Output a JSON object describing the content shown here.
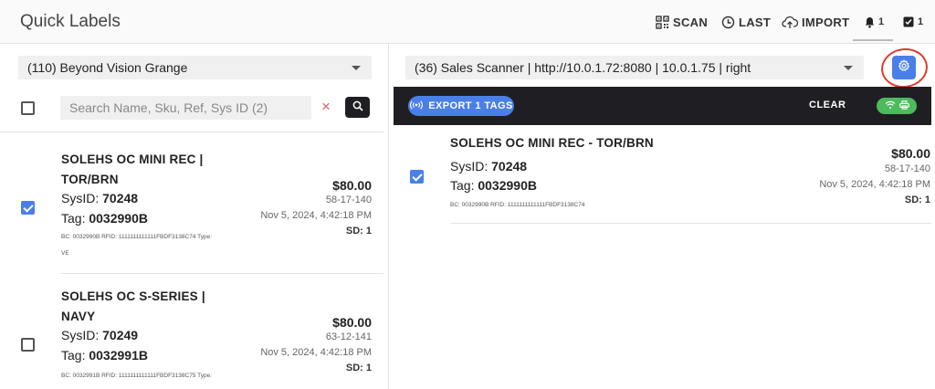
{
  "app": {
    "title": "Quick Labels"
  },
  "nav": {
    "scan_label": "SCAN",
    "last_label": "LAST",
    "import_label": "IMPORT",
    "bell_count": "1",
    "check_count": "1"
  },
  "left": {
    "store_select": "(110) Beyond Vision Grange",
    "search_placeholder": "Search Name, Sku, Ref, Sys ID (2)",
    "clear_symbol": "×",
    "items": [
      {
        "name_line1": "SOLEHS OC MINI REC |",
        "name_line2": "TOR/BRN",
        "sysid_label": "SysID: ",
        "sysid": "70248",
        "tag_label": "Tag: ",
        "tag": "0032990B",
        "price": "$80.00",
        "code": "58-17-140",
        "date": "Nov 5, 2024, 4:42:18 PM",
        "sd": "SD: 1",
        "small_line1": "BC: 0032990B RFID: 1111111111111FBDF3138C74 Type:",
        "small_line2": "VE",
        "checked": true
      },
      {
        "name_line1": "SOLEHS OC S-SERIES |",
        "name_line2": "NAVY",
        "sysid_label": "SysID: ",
        "sysid": "70249",
        "tag_label": "Tag: ",
        "tag": "0032991B",
        "price": "$80.00",
        "code": "63-12-141",
        "date": "Nov 5, 2024, 4:42:18 PM",
        "sd": "SD: 1",
        "small_line1": "BC: 0032991B RFID: 1111111111111FBDF3138C75 Type:",
        "checked": false
      }
    ]
  },
  "right": {
    "printer_select": "(36) Sales Scanner | http://10.0.1.72:8080 | 10.0.1.75 | right",
    "export_label": "EXPORT 1 TAGS",
    "clear_label": "CLEAR",
    "item": {
      "name": "SOLEHS OC MINI REC - TOR/BRN",
      "sysid_label": "SysID: ",
      "sysid": "70248",
      "tag_label": "Tag: ",
      "tag": "0032990B",
      "price": "$80.00",
      "code": "58-17-140",
      "date": "Nov 5, 2024, 4:42:18 PM",
      "sd": "SD: 1",
      "small": "BC: 0032990B RFID: 1111111111111FBDF3138C74",
      "checked": true
    }
  },
  "colors": {
    "accent": "#4a7fe8",
    "toolbar": "#1f1f23",
    "toggle_green": "#4cbb5c",
    "annotation_red": "#e23a2f",
    "clear_red": "#e06060"
  }
}
